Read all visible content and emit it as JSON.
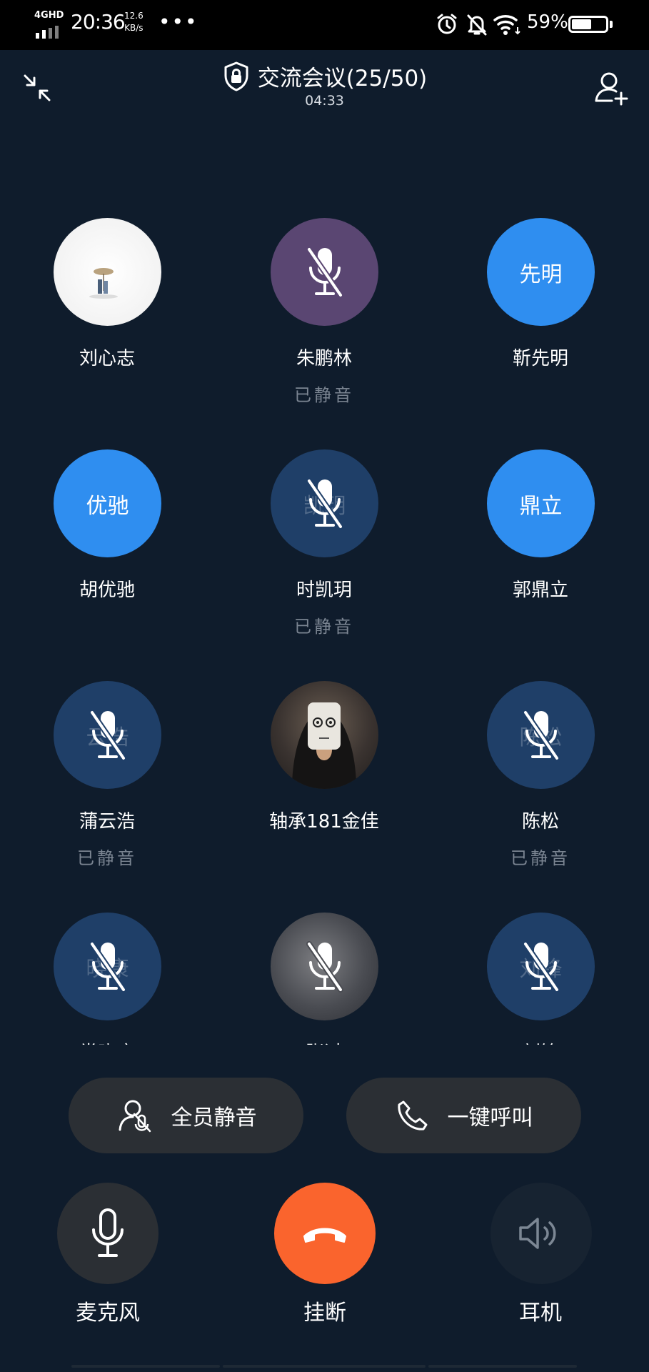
{
  "status_bar": {
    "network": "4GHD",
    "time": "20:36",
    "speed_value": "12.6",
    "speed_unit": "KB/s",
    "more": "•••",
    "battery_percent": "59%",
    "battery_level": 0.59
  },
  "header": {
    "title": "交流会议(25/50)",
    "timer": "04:33"
  },
  "participants": [
    {
      "name": "刘心志",
      "status": "",
      "avatar_type": "photo",
      "avatar_text": ""
    },
    {
      "name": "朱鹏林",
      "status": "已静音",
      "avatar_type": "purple",
      "avatar_text": ""
    },
    {
      "name": "靳先明",
      "status": "",
      "avatar_type": "blue",
      "avatar_text": "先明"
    },
    {
      "name": "胡优驰",
      "status": "",
      "avatar_type": "blue",
      "avatar_text": "优驰"
    },
    {
      "name": "时凯玥",
      "status": "已静音",
      "avatar_type": "dark",
      "avatar_text": "凯玥"
    },
    {
      "name": "郭鼎立",
      "status": "",
      "avatar_type": "blue",
      "avatar_text": "鼎立"
    },
    {
      "name": "蒲云浩",
      "status": "已静音",
      "avatar_type": "dark",
      "avatar_text": "云浩"
    },
    {
      "name": "轴承181金佳",
      "status": "",
      "avatar_type": "photo",
      "avatar_text": ""
    },
    {
      "name": "陈松",
      "status": "已静音",
      "avatar_type": "dark",
      "avatar_text": "陈松"
    },
    {
      "name": "常晓康",
      "status": "",
      "avatar_type": "dark",
      "avatar_text": "晓康"
    },
    {
      "name": "张过",
      "status": "",
      "avatar_type": "photo",
      "avatar_text": ""
    },
    {
      "name": "刘锋",
      "status": "",
      "avatar_type": "dark",
      "avatar_text": "刘锋"
    }
  ],
  "actions": {
    "mute_all": "全员静音",
    "call_all": "一键呼叫"
  },
  "controls": {
    "microphone": "麦克风",
    "hangup": "挂断",
    "earpiece": "耳机"
  },
  "colors": {
    "background": "#0f1c2c",
    "avatar_blue": "#2f8ef0",
    "avatar_dark": "#1f3f68",
    "hangup": "#fa642d",
    "pill": "#2b2f34"
  }
}
